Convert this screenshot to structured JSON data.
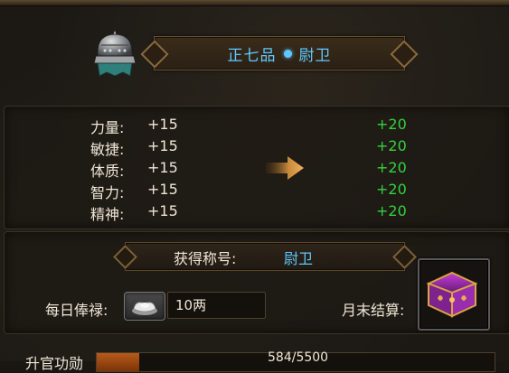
{
  "rank": {
    "grade": "正七品",
    "title": "尉卫"
  },
  "stats": [
    {
      "label": "力量:",
      "current": "+15",
      "next": "+20"
    },
    {
      "label": "敏捷:",
      "current": "+15",
      "next": "+20"
    },
    {
      "label": "体质:",
      "current": "+15",
      "next": "+20"
    },
    {
      "label": "智力:",
      "current": "+15",
      "next": "+20"
    },
    {
      "label": "精神:",
      "current": "+15",
      "next": "+20"
    }
  ],
  "honor": {
    "label": "获得称号:",
    "value": "尉卫"
  },
  "salary": {
    "label": "每日俸禄:",
    "value": "10两"
  },
  "monthly": {
    "label": "月末结算:"
  },
  "merit": {
    "label": "升官功勋",
    "value": "584/5500",
    "progress_fraction": 0.106
  },
  "colors": {
    "rank_blue": "#5fc8ff",
    "bonus_green": "#34d23e"
  },
  "icons": {
    "helmet": "helmet-icon",
    "arrow": "arrow-right-icon",
    "silver": "silver-ingot-icon",
    "chest": "treasure-chest-icon"
  }
}
